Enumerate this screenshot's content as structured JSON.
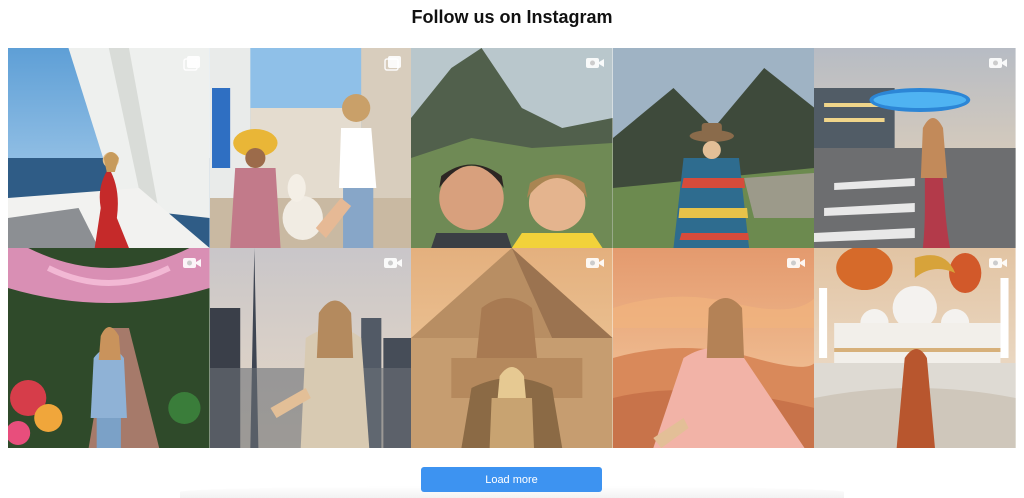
{
  "section": {
    "title": "Follow us on Instagram"
  },
  "gallery": {
    "tiles": [
      {
        "subject": "woman in red dress on sailboat",
        "badge": "gallery-icon"
      },
      {
        "subject": "street with local woman and alpaca",
        "badge": "gallery-icon"
      },
      {
        "subject": "couple selfie at Machu Picchu",
        "badge": "video-icon"
      },
      {
        "subject": "traveler in poncho at Machu Picchu",
        "badge": ""
      },
      {
        "subject": "woman at City Walk at dusk",
        "badge": "video-icon"
      },
      {
        "subject": "woman in flower garden",
        "badge": "video-icon"
      },
      {
        "subject": "woman facing city skyline and tower",
        "badge": "video-icon"
      },
      {
        "subject": "woman at Sphinx and pyramid",
        "badge": "video-icon"
      },
      {
        "subject": "woman in pink gown in desert",
        "badge": "video-icon"
      },
      {
        "subject": "woman at mosque with lanterns",
        "badge": "video-icon"
      }
    ]
  },
  "actions": {
    "load_more_label": "Load more"
  },
  "colors": {
    "button": "#3d93f1",
    "title": "#111111"
  }
}
